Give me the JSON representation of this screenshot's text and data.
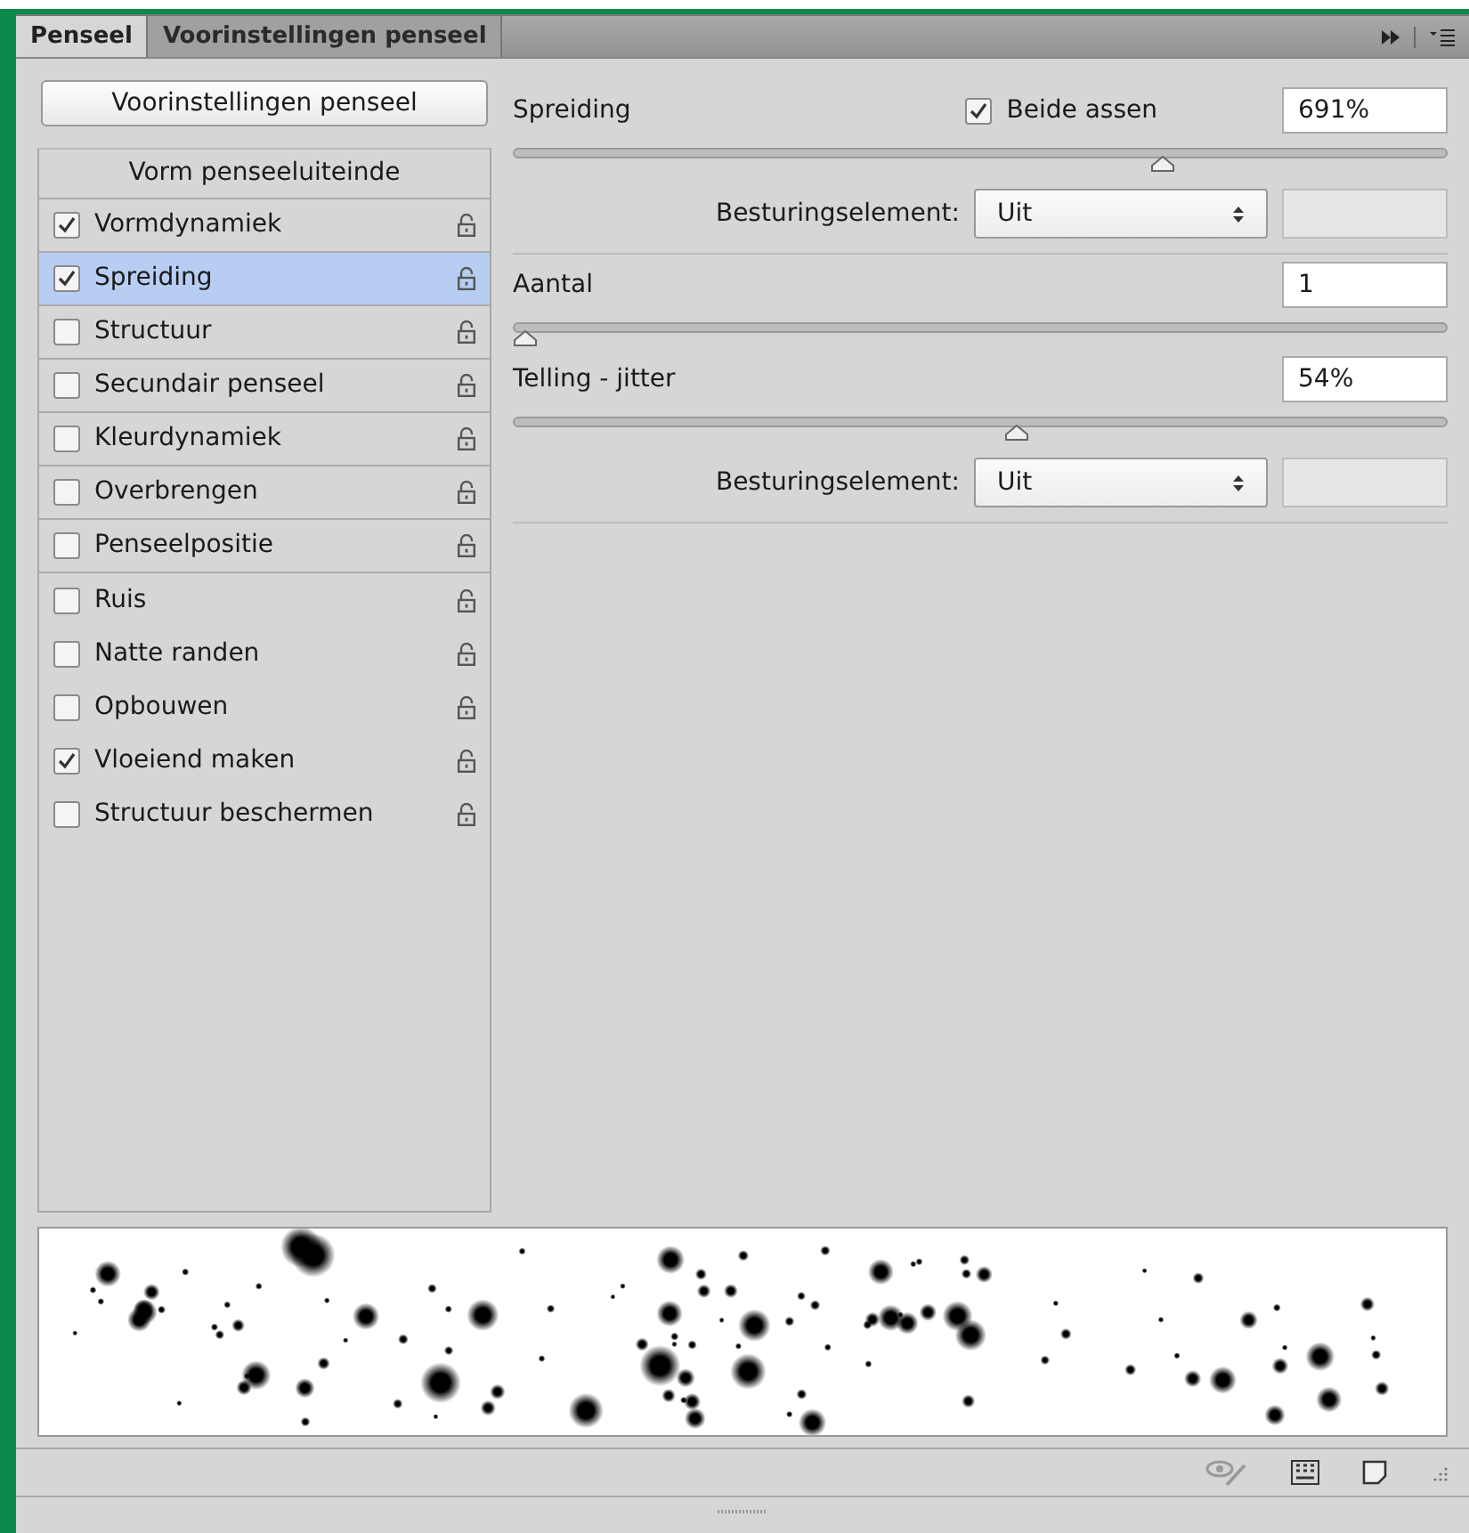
{
  "tabs": [
    {
      "label": "Penseel",
      "selected": true
    },
    {
      "label": "Voorinstellingen penseel",
      "selected": false
    }
  ],
  "presets_button": "Voorinstellingen penseel",
  "list_heading": "Vorm penseeluiteinde",
  "options": [
    {
      "label": "Vormdynamiek",
      "checked": true,
      "selected": false,
      "kind": "section"
    },
    {
      "label": "Spreiding",
      "checked": true,
      "selected": true,
      "kind": "section"
    },
    {
      "label": "Structuur",
      "checked": false,
      "selected": false,
      "kind": "section"
    },
    {
      "label": "Secundair penseel",
      "checked": false,
      "selected": false,
      "kind": "section"
    },
    {
      "label": "Kleurdynamiek",
      "checked": false,
      "selected": false,
      "kind": "section"
    },
    {
      "label": "Overbrengen",
      "checked": false,
      "selected": false,
      "kind": "section"
    },
    {
      "label": "Penseelpositie",
      "checked": false,
      "selected": false,
      "kind": "section"
    },
    {
      "label": "Ruis",
      "checked": false,
      "selected": false,
      "kind": "option"
    },
    {
      "label": "Natte randen",
      "checked": false,
      "selected": false,
      "kind": "option"
    },
    {
      "label": "Opbouwen",
      "checked": false,
      "selected": false,
      "kind": "option"
    },
    {
      "label": "Vloeiend maken",
      "checked": true,
      "selected": false,
      "kind": "option"
    },
    {
      "label": "Structuur beschermen",
      "checked": false,
      "selected": false,
      "kind": "option"
    }
  ],
  "settings": [
    {
      "label": "Spreiding",
      "checkbox": {
        "label": "Beide assen",
        "checked": true
      },
      "value": "691%",
      "level": 0.7,
      "control": {
        "label": "Besturingselement:",
        "value": "Uit"
      }
    },
    {
      "label": "Aantal",
      "value": "1",
      "level": 0
    },
    {
      "label": "Telling - jitter",
      "value": "54%",
      "level": 0.54,
      "control": {
        "label": "Besturingselement:",
        "value": "Uit"
      }
    }
  ]
}
